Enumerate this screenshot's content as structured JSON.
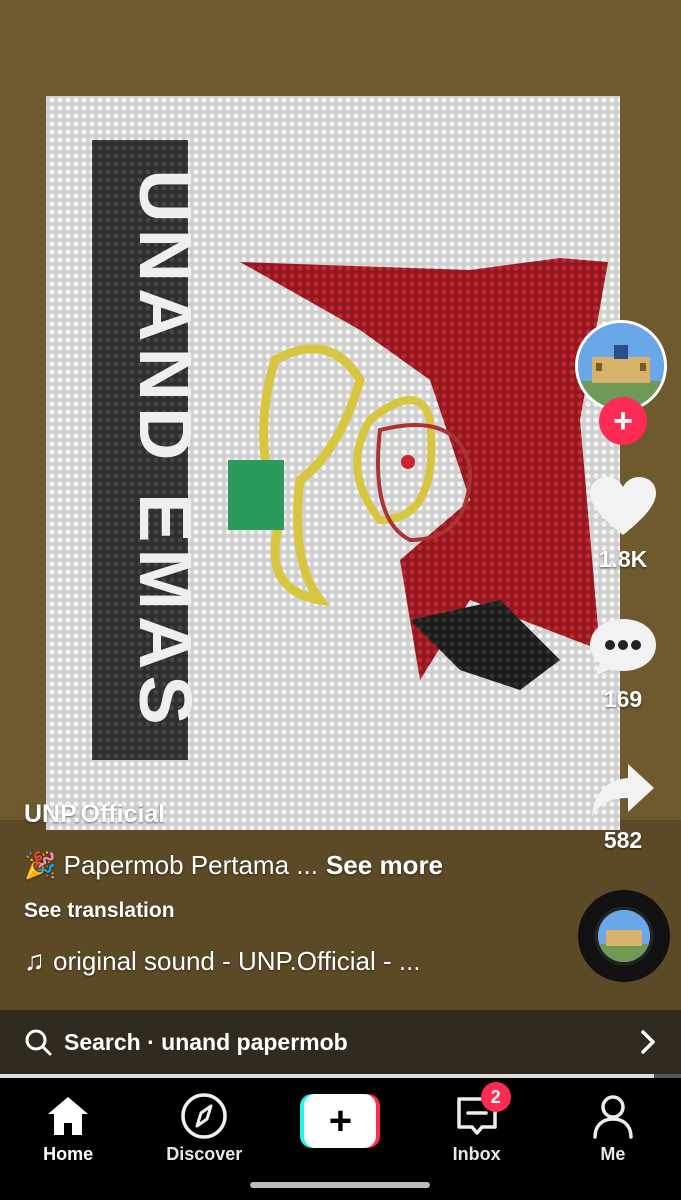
{
  "video": {
    "mosaic_text": "UNAND EMAS"
  },
  "creator": {
    "username": "UNP.Official",
    "follow_symbol": "+"
  },
  "actions": {
    "likes": "1.8K",
    "comments": "169",
    "shares": "582"
  },
  "caption": {
    "emoji": "🎉",
    "text": "Papermob Pertama ...",
    "see_more": "See more",
    "see_translation": "See translation"
  },
  "sound": {
    "note": "♫",
    "title": "original sound - UNP.Official - ..."
  },
  "search": {
    "label": "Search · unand papermob",
    "icon": "search-icon",
    "chevron": "chevron-right-icon"
  },
  "playback": {
    "progress": 0.96
  },
  "nav": {
    "home": "Home",
    "discover": "Discover",
    "create_symbol": "+",
    "inbox": "Inbox",
    "inbox_badge": "2",
    "me": "Me"
  },
  "colors": {
    "accent": "#fe2c55",
    "cyan": "#25f4ee",
    "ground": "#6f5a2f",
    "mosaic_red": "#b8202a"
  }
}
